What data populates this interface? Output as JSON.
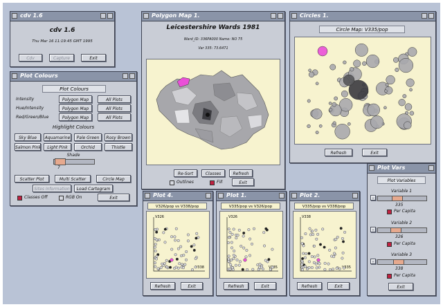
{
  "cdv": {
    "title": "cdv 1.6",
    "heading": "cdv 1.6",
    "date": "Thu Mar 16 11:19:45 GMT 1995",
    "buttons": [
      "Cdv",
      "Capture",
      "Exit"
    ]
  },
  "plot_colours": {
    "title": "Plot Colours",
    "heading": "Plot Colours",
    "rows": [
      {
        "label": "Intensity",
        "b1": "Polygon Map",
        "b2": "All Plots"
      },
      {
        "label": "Hue/Intensity",
        "b1": "Polygon Map",
        "b2": "All Plots"
      },
      {
        "label": "Red/Green/Blue",
        "b1": "Polygon Map",
        "b2": "All Plots"
      }
    ],
    "highlight_heading": "Highlight Colours",
    "colours_row1": [
      "Sky Blue",
      "Aquamarine",
      "Pale Green",
      "Rosy Brown"
    ],
    "colours_row2": [
      "Salmon Pink",
      "Light Pink",
      "Orchid",
      "Thistle"
    ],
    "shade_label": "Shade",
    "shade_value": "7",
    "plot_buttons": [
      "Scatter Plot",
      "Multi Scatter",
      "Circle Map"
    ],
    "extra_buttons": [
      "Sites Information",
      "Load Cartogram"
    ],
    "classes_off": "Classes Off",
    "rgb_on": "RGB On",
    "exit": "Exit"
  },
  "polygon_map": {
    "title": "Polygon Map 1.",
    "heading": "Leicestershire Wards 1981",
    "info1": "Ward_ID: 336PA000 Name: NO 75",
    "info2": "Var 335: 73.6471",
    "buttons": [
      "Re-Sort",
      "Classes",
      "Refresh"
    ],
    "outlines": "Outlines",
    "fill": "Fill",
    "exit": "Exit"
  },
  "circles": {
    "title": "Circles 1.",
    "heading": "Circle Map: V335/pop",
    "buttons": [
      "Refresh",
      "Exit"
    ]
  },
  "plot_vars": {
    "title": "Plot Vars",
    "heading": "Plot Variables",
    "vars": [
      {
        "label": "Variable 1",
        "value": "335",
        "per": "Per Capita"
      },
      {
        "label": "Variable 2",
        "value": "326",
        "per": "Per Capita"
      },
      {
        "label": "Variable 3",
        "value": "338",
        "per": "Per Capita"
      }
    ],
    "exit": "Exit"
  },
  "plots": [
    {
      "title": "Plot 4.",
      "subtitle": "V326/pop vs V338/pop",
      "ylab": "V326",
      "xlab": "V338",
      "buttons": [
        "Refresh",
        "Exit"
      ]
    },
    {
      "title": "Plot 1.",
      "subtitle": "V335/pop vs V326/pop",
      "ylab": "V326",
      "xlab": "V335",
      "buttons": [
        "Refresh",
        "Exit"
      ]
    },
    {
      "title": "Plot 2.",
      "subtitle": "V335/pop vs V338/pop",
      "ylab": "V338",
      "xlab": "V335",
      "buttons": [
        "Refresh",
        "Exit"
      ]
    }
  ],
  "colors": {
    "desktop": "#b9c3d6",
    "panel": "#c9cdd6",
    "plot_bg": "#f7f3cf",
    "highlight": "#ea4fd8",
    "titlebar": "#8a94a8"
  }
}
